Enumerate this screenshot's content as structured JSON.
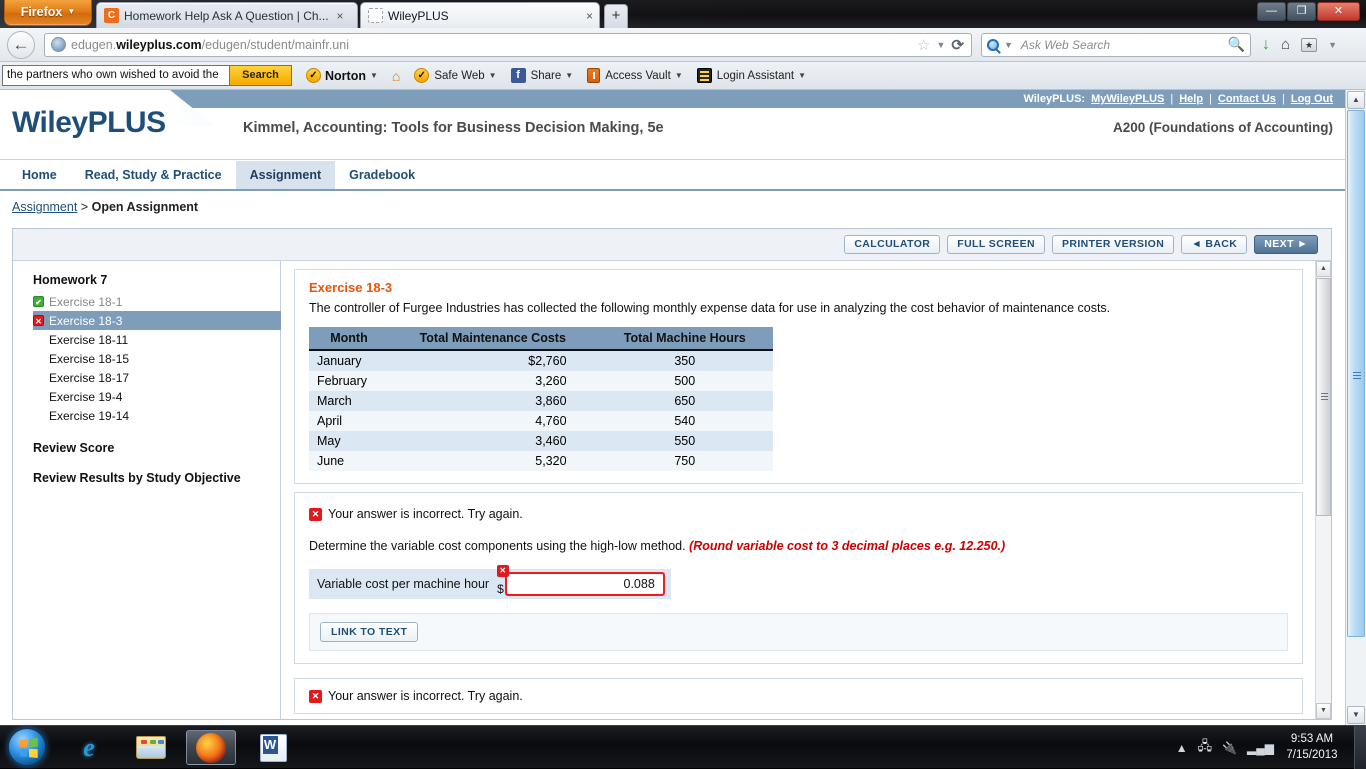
{
  "browser": {
    "app_button": "Firefox",
    "tabs": [
      {
        "title": "Homework Help Ask A Question | Ch...",
        "favicon": "chegg-favicon",
        "active": false
      },
      {
        "title": "WileyPLUS",
        "favicon": "blank-favicon",
        "active": true
      }
    ],
    "new_tab_label": "+",
    "window_controls": {
      "minimize": "—",
      "restore": "❐",
      "close": "✕"
    },
    "url": {
      "prefix": "edugen.",
      "domain": "wileyplus.com",
      "path": "/edugen/student/mainfr.uni"
    },
    "search": {
      "placeholder": "Ask Web Search"
    },
    "back_label": "←",
    "reload_label": "⟳",
    "star_label": "☆"
  },
  "addon_toolbar": {
    "search_query": "the partners who own wished to avoid the",
    "search_button": "Search",
    "items": [
      {
        "label": "Norton",
        "icon": "norton-check-icon"
      },
      {
        "label": "",
        "icon": "home-icon"
      },
      {
        "label": "Safe Web",
        "icon": "safeweb-check-icon"
      },
      {
        "label": "Share",
        "icon": "facebook-icon"
      },
      {
        "label": "Access Vault",
        "icon": "vault-icon"
      },
      {
        "label": "Login Assistant",
        "icon": "login-assistant-icon"
      }
    ]
  },
  "wileyplus": {
    "top_nav": {
      "prefix": "WileyPLUS:",
      "links": [
        "MyWileyPLUS",
        "Help",
        "Contact Us",
        "Log Out"
      ],
      "separator": "|"
    },
    "logo": "WileyPLUS",
    "book_title": "Kimmel, Accounting: Tools for Business Decision Making, 5e",
    "course": "A200 (Foundations of Accounting)",
    "tabs": [
      {
        "label": "Home",
        "active": false
      },
      {
        "label": "Read, Study & Practice",
        "active": false
      },
      {
        "label": "Assignment",
        "active": true
      },
      {
        "label": "Gradebook",
        "active": false
      }
    ],
    "breadcrumb": {
      "link": "Assignment",
      "separator": ">",
      "current": "Open Assignment"
    }
  },
  "toolbar": {
    "calculator": "CALCULATOR",
    "full_screen": "FULL SCREEN",
    "printer_version": "PRINTER VERSION",
    "back": "◄ BACK",
    "next": "NEXT ►"
  },
  "sidebar": {
    "title": "Homework 7",
    "items": [
      {
        "label": "Exercise 18-1",
        "status": "correct",
        "selected": false
      },
      {
        "label": "Exercise 18-3",
        "status": "incorrect",
        "selected": true
      },
      {
        "label": "Exercise 18-11",
        "status": "none",
        "selected": false
      },
      {
        "label": "Exercise 18-15",
        "status": "none",
        "selected": false
      },
      {
        "label": "Exercise 18-17",
        "status": "none",
        "selected": false
      },
      {
        "label": "Exercise 19-4",
        "status": "none",
        "selected": false
      },
      {
        "label": "Exercise 19-14",
        "status": "none",
        "selected": false
      }
    ],
    "review_score": "Review Score",
    "review_results": "Review Results by Study Objective"
  },
  "exercise": {
    "title": "Exercise 18-3",
    "description": "The controller of Furgee Industries has collected the following monthly expense data for use in analyzing the cost behavior of maintenance costs.",
    "table": {
      "headers": [
        "Month",
        "Total Maintenance Costs",
        "Total Machine Hours"
      ],
      "rows": [
        {
          "month": "January",
          "cost": "$2,760",
          "hours": "350"
        },
        {
          "month": "February",
          "cost": "3,260",
          "hours": "500"
        },
        {
          "month": "March",
          "cost": "3,860",
          "hours": "650"
        },
        {
          "month": "April",
          "cost": "4,760",
          "hours": "540"
        },
        {
          "month": "May",
          "cost": "3,460",
          "hours": "550"
        },
        {
          "month": "June",
          "cost": "5,320",
          "hours": "750"
        }
      ]
    },
    "feedback": "Your answer is incorrect.  Try again.",
    "prompt_text": "Determine the variable cost components using the high-low method. ",
    "prompt_hint": "(Round variable cost to 3 decimal places e.g. 12.250.)",
    "answer": {
      "label": "Variable cost per machine hour",
      "currency": "$",
      "value": "0.088"
    },
    "link_to_text": "LINK TO TEXT",
    "next_feedback": "Your answer is incorrect.  Try again."
  },
  "taskbar": {
    "time": "9:53 AM",
    "date": "7/15/2013",
    "apps": [
      {
        "name": "internet-explorer",
        "active": false
      },
      {
        "name": "windows-explorer",
        "active": false
      },
      {
        "name": "firefox",
        "active": true
      },
      {
        "name": "microsoft-word",
        "active": false
      }
    ]
  },
  "colors": {
    "wiley_blue": "#1f4e79",
    "header_band": "#7d9dbb",
    "exercise_orange": "#e8540c",
    "error_red": "#e11b1b",
    "hint_red": "#cc0000"
  }
}
